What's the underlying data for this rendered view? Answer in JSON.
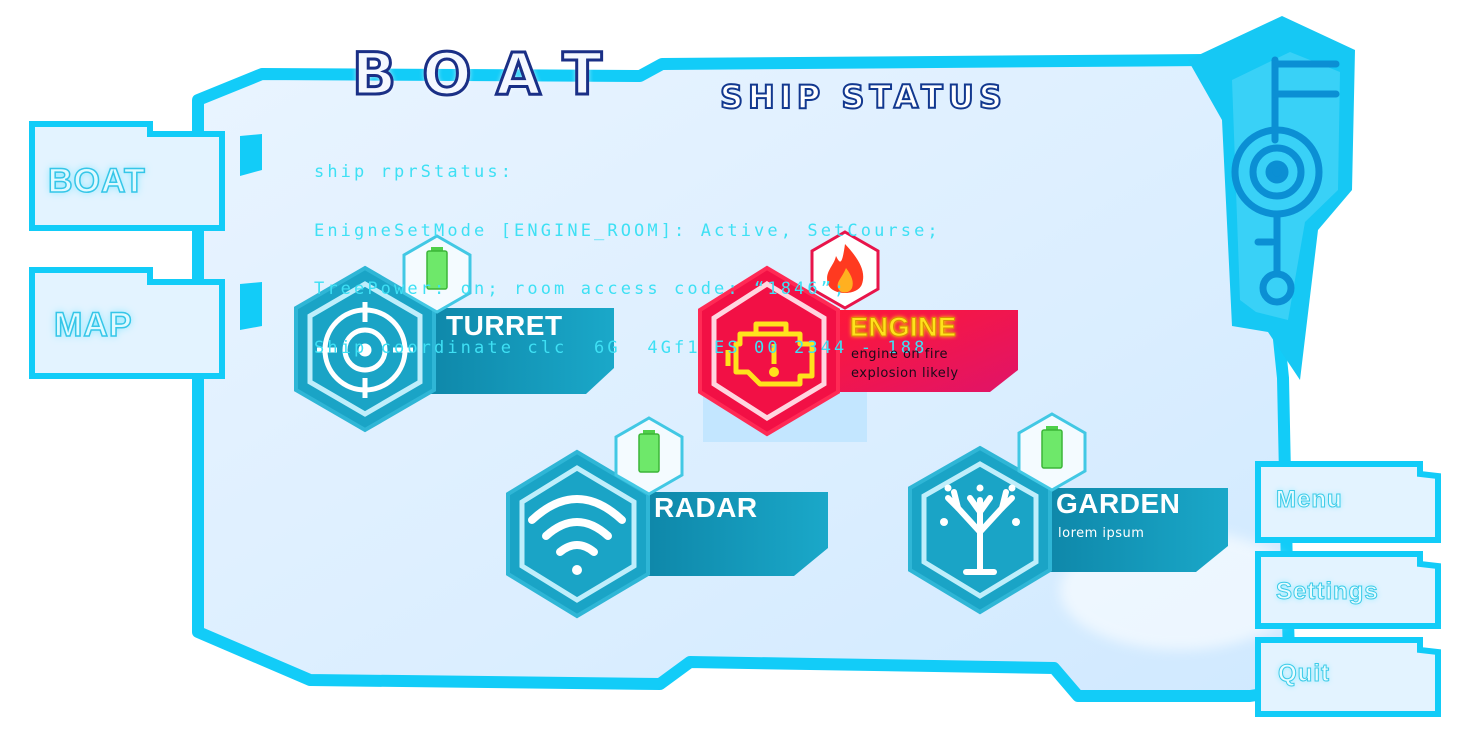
{
  "title": "BOAT",
  "panel_title": "SHIP STATUS",
  "console_lines": [
    "ship rprStatus:",
    "EnigneSetMode [ENGINE_ROOM]: Active, SetCourse;",
    "TreePower: on; room access code: “1846”;",
    "Ship coordinate clc  6G  4Gf1 ES 00 2344 - 188"
  ],
  "left_tabs": [
    {
      "label": "BOAT"
    },
    {
      "label": "MAP"
    }
  ],
  "right_menu": [
    {
      "label": "Menu"
    },
    {
      "label": "Settings"
    },
    {
      "label": "Quit"
    }
  ],
  "modules": {
    "turret": {
      "name": "TURRET",
      "icon": "crosshair-icon",
      "status_icon": "battery-icon"
    },
    "engine": {
      "name": "ENGINE",
      "desc": [
        "engine on fire",
        "explosion likely"
      ],
      "icon": "check-engine-icon",
      "status_icon": "fire-icon"
    },
    "radar": {
      "name": "RADAR",
      "icon": "wifi-icon",
      "status_icon": "battery-icon"
    },
    "garden": {
      "name": "GARDEN",
      "desc": [
        "lorem ipsum"
      ],
      "icon": "tree-icon",
      "status_icon": "battery-icon"
    }
  },
  "colors": {
    "frame": "#12ccf8",
    "panel": "#deefff",
    "module_teal": "#1295b6",
    "alert_red": "#f21045",
    "alert_yellow": "#ffe21c",
    "console_text": "#3ee0f4",
    "title_outline": "#1a2f86",
    "battery": "#5fe05a"
  }
}
